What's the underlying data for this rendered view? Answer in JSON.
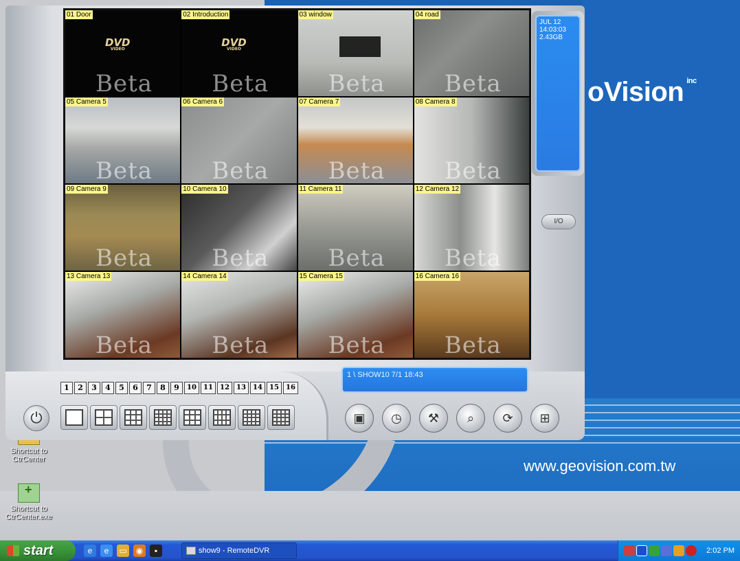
{
  "cameras": [
    {
      "label": "01 Door",
      "scene": "sc-black",
      "dvd": true
    },
    {
      "label": "02 Introduction",
      "scene": "sc-black",
      "dvd": true
    },
    {
      "label": "03 window",
      "scene": "sc-window",
      "box": true
    },
    {
      "label": "04 road",
      "scene": "sc-road"
    },
    {
      "label": "05 Camera 5",
      "scene": "sc-office"
    },
    {
      "label": "06 Camera 6",
      "scene": "sc-building"
    },
    {
      "label": "07 Camera 7",
      "scene": "sc-office2"
    },
    {
      "label": "08 Camera 8",
      "scene": "sc-lobby"
    },
    {
      "label": "09 Camera 9",
      "scene": "sc-wood"
    },
    {
      "label": "10 Camera 10",
      "scene": "sc-dark"
    },
    {
      "label": "11 Camera 11",
      "scene": "sc-room"
    },
    {
      "label": "12 Camera 12",
      "scene": "sc-corr"
    },
    {
      "label": "13 Camera 13",
      "scene": "sc-glass"
    },
    {
      "label": "14 Camera 14",
      "scene": "sc-glass2"
    },
    {
      "label": "15 Camera 15",
      "scene": "sc-glass"
    },
    {
      "label": "16 Camera 16",
      "scene": "sc-warm"
    }
  ],
  "watermark": "Beta",
  "dvd_text": "DVD",
  "dvd_sub": "VIDEO",
  "info": {
    "date": "JUL 12",
    "time": "14:03:03",
    "disk": "2.43GB"
  },
  "status_text": "1 \\ SHOW10 7/1 18:43",
  "channels": [
    "1",
    "2",
    "3",
    "4",
    "5",
    "6",
    "7",
    "8",
    "9",
    "10",
    "11",
    "12",
    "13",
    "14",
    "15",
    "16"
  ],
  "layouts": [
    {
      "name": "layout-1",
      "cols": 1,
      "rows": 1
    },
    {
      "name": "layout-4",
      "cols": 2,
      "rows": 2
    },
    {
      "name": "layout-6",
      "cols": 3,
      "rows": 3
    },
    {
      "name": "layout-8",
      "cols": 4,
      "rows": 4
    },
    {
      "name": "layout-9",
      "cols": 3,
      "rows": 3
    },
    {
      "name": "layout-10",
      "cols": 4,
      "rows": 3
    },
    {
      "name": "layout-13",
      "cols": 4,
      "rows": 4
    },
    {
      "name": "layout-16",
      "cols": 4,
      "rows": 4,
      "active": true
    }
  ],
  "func_buttons": [
    {
      "name": "monitor-button",
      "icon": "▣"
    },
    {
      "name": "schedule-button",
      "icon": "◷"
    },
    {
      "name": "tools-button",
      "icon": "⚒"
    },
    {
      "name": "search-button",
      "icon": "⌕"
    },
    {
      "name": "network-button",
      "icon": "⟳"
    },
    {
      "name": "connection-button",
      "icon": "⊞"
    }
  ],
  "snapshot_label": "I/O",
  "brand": {
    "logo": "oVision",
    "inc": "inc",
    "url": "www.geovision.com.tw"
  },
  "desktop_icons": [
    {
      "label": "Shortcut to CtrCenter"
    },
    {
      "label": "Shortcut to CtrCenter.exe"
    }
  ],
  "taskbar": {
    "start": "start",
    "task": "show9 - RemoteDVR",
    "clock": "2:02 PM"
  }
}
